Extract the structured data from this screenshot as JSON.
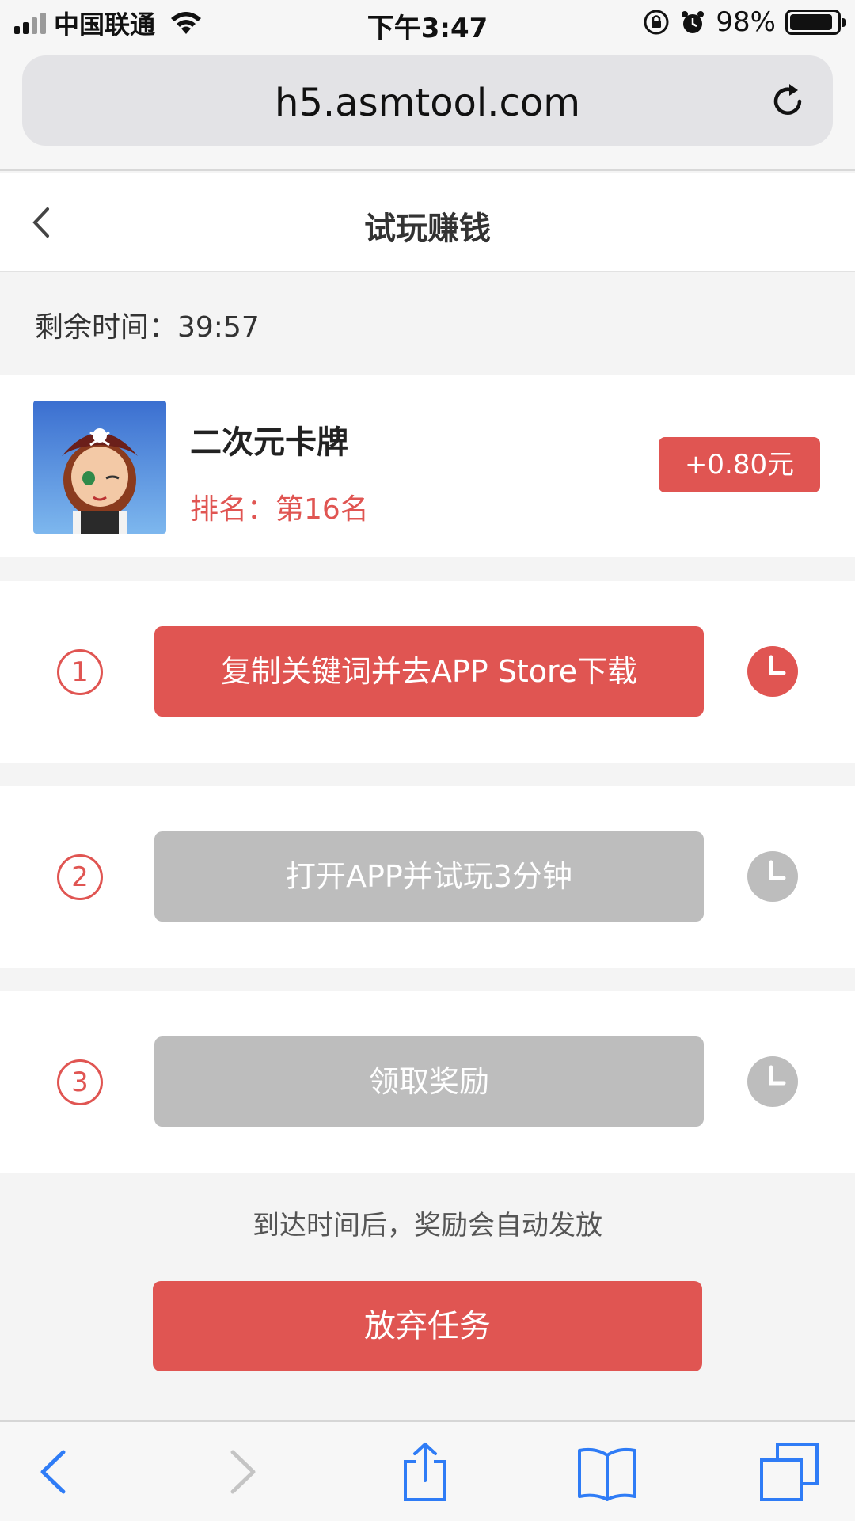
{
  "status_bar": {
    "carrier": "中国联通",
    "time": "下午3:47",
    "battery_percent": "98%",
    "battery_level": 0.98,
    "icons": [
      "signal-icon",
      "wifi-icon",
      "orientation-lock-icon",
      "alarm-icon",
      "battery-icon"
    ]
  },
  "browser": {
    "url": "h5.asmtool.com",
    "reload_icon": "reload-icon"
  },
  "header": {
    "title": "试玩赚钱",
    "back_icon": "chevron-left-icon"
  },
  "timer": {
    "label": "剩余时间：39:57"
  },
  "game": {
    "name": "二次元卡牌",
    "rank": "排名：第16名",
    "reward": "+0.80元"
  },
  "steps": [
    {
      "number": "1",
      "label": "复制关键词并去APP Store下载",
      "state": "active"
    },
    {
      "number": "2",
      "label": "打开APP并试玩3分钟",
      "state": "disabled"
    },
    {
      "number": "3",
      "label": "领取奖励",
      "state": "disabled"
    }
  ],
  "note": "到达时间后，奖励会自动发放",
  "abandon_label": "放弃任务",
  "colors": {
    "accent": "#e05552",
    "disabled": "#bdbdbd",
    "toolbar_blue": "#2f7cf6"
  },
  "toolbar": {
    "icons": [
      "back-icon",
      "forward-icon",
      "share-icon",
      "bookmarks-icon",
      "tabs-icon"
    ]
  }
}
